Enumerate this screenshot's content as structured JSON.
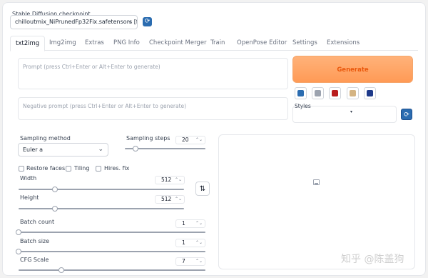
{
  "checkpoint": {
    "label": "Stable Diffusion checkpoint",
    "value": "chilloutmix_NiPrunedFp32Fix.safetensors [fc251",
    "refresh_symbol": "⟳"
  },
  "tabs": [
    {
      "label": "txt2img",
      "active": true
    },
    {
      "label": "Img2img"
    },
    {
      "label": "Extras"
    },
    {
      "label": "PNG Info"
    },
    {
      "label": "Checkpoint Merger"
    },
    {
      "label": "Train"
    },
    {
      "label": "OpenPose Editor"
    },
    {
      "label": "Settings"
    },
    {
      "label": "Extensions"
    }
  ],
  "prompt": {
    "placeholder": "Prompt (press Ctrl+Enter or Alt+Enter to generate)"
  },
  "negative_prompt": {
    "placeholder": "Negative prompt (press Ctrl+Enter or Alt+Enter to generate)"
  },
  "generate": {
    "label": "Generate"
  },
  "styles": {
    "label": "Styles",
    "chevron": "▾",
    "refresh_symbol": "⟳"
  },
  "sampling": {
    "method_label": "Sampling method",
    "method_value": "Euler a",
    "steps_label": "Sampling steps",
    "steps_value": "20",
    "steps_fraction": 0.13
  },
  "options": {
    "restore_faces": "Restore faces",
    "tiling": "Tiling",
    "hires_fix": "Hires. fix"
  },
  "width": {
    "label": "Width",
    "value": "512",
    "fraction": 0.22
  },
  "height": {
    "label": "Height",
    "value": "512",
    "fraction": 0.22
  },
  "swap_symbol": "⇅",
  "batch_count": {
    "label": "Batch count",
    "value": "1",
    "fraction": 0.0
  },
  "batch_size": {
    "label": "Batch size",
    "value": "1",
    "fraction": 0.0
  },
  "cfg_scale": {
    "label": "CFG Scale",
    "value": "7",
    "fraction": 0.23
  },
  "spinner_symbol": "⌃⌄",
  "watermark": "知乎 @陈盖狗",
  "colors": {
    "accent": "#ff9a56",
    "accent_text": "#ea580c",
    "refresh": "#2b6cb0"
  }
}
